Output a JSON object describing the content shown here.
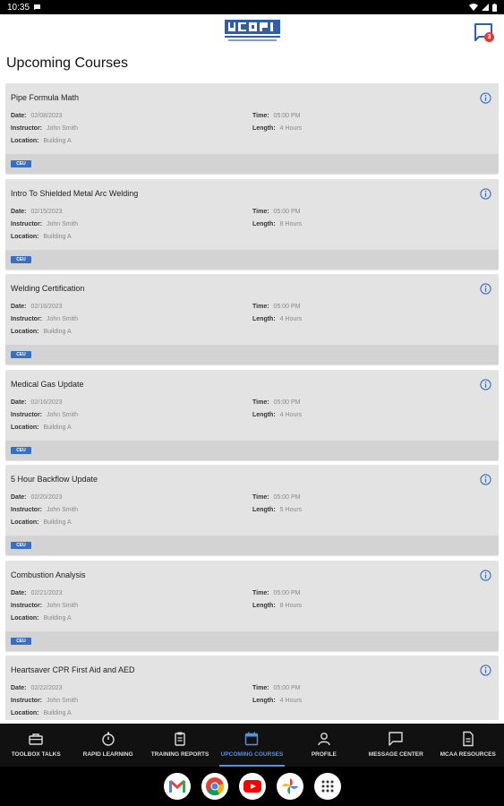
{
  "status_bar": {
    "time": "10:35"
  },
  "header": {
    "message_badge_count": "3"
  },
  "page_title": "Upcoming Courses",
  "field_labels": {
    "date": "Date:",
    "instructor": "Instructor:",
    "location": "Location:",
    "time": "Time:",
    "length": "Length:"
  },
  "courses": [
    {
      "title": "Pipe Formula Math",
      "date": "02/08/2023",
      "instructor": "John Smith",
      "location": "Building A",
      "time": "05:00 PM",
      "length": "4 Hours",
      "badge": "CEU"
    },
    {
      "title": "Intro To Shielded Metal Arc Welding",
      "date": "02/15/2023",
      "instructor": "John Smith",
      "location": "Building A",
      "time": "05:00 PM",
      "length": "8 Hours",
      "badge": "CEU"
    },
    {
      "title": "Welding Certification",
      "date": "02/16/2023",
      "instructor": "John Smith",
      "location": "Building A",
      "time": "05:00 PM",
      "length": "4 Hours",
      "badge": "CEU"
    },
    {
      "title": "Medical Gas Update",
      "date": "02/16/2023",
      "instructor": "John Smith",
      "location": "Building A",
      "time": "05:00 PM",
      "length": "4 Hours",
      "badge": "CEU"
    },
    {
      "title": "5 Hour Backflow Update",
      "date": "02/20/2023",
      "instructor": "John Smith",
      "location": "Building A",
      "time": "05:00 PM",
      "length": "5 Hours",
      "badge": "CEU"
    },
    {
      "title": "Combustion Analysis",
      "date": "02/21/2023",
      "instructor": "John Smith",
      "location": "Building A",
      "time": "05:00 PM",
      "length": "8 Hours",
      "badge": "CEU"
    },
    {
      "title": "Heartsaver CPR First Aid and AED",
      "date": "02/22/2023",
      "instructor": "John Smith",
      "location": "Building A",
      "time": "05:00 PM",
      "length": "4 Hours",
      "badge": ""
    }
  ],
  "bottom_nav": [
    {
      "label": "TOOLBOX TALKS",
      "icon": "toolbox-icon",
      "active": false
    },
    {
      "label": "RAPID LEARNING",
      "icon": "stopwatch-icon",
      "active": false
    },
    {
      "label": "TRAINING REPORTS",
      "icon": "clipboard-icon",
      "active": false
    },
    {
      "label": "UPCOMING COURSES",
      "icon": "calendar-icon",
      "active": true
    },
    {
      "label": "PROFILE",
      "icon": "person-icon",
      "active": false
    },
    {
      "label": "MESSAGE CENTER",
      "icon": "chat-icon",
      "active": false
    },
    {
      "label": "MCAA RESOURCES",
      "icon": "document-icon",
      "active": false
    }
  ],
  "dock": [
    "gmail-icon",
    "chrome-icon",
    "youtube-icon",
    "photos-icon",
    "app-drawer-icon"
  ],
  "colors": {
    "accent": "#5b8fe0",
    "badge": "#3a6fbf",
    "card_bg": "#e3e3e3",
    "card_footer": "#d3d3d3",
    "nav_bg": "#111111"
  }
}
